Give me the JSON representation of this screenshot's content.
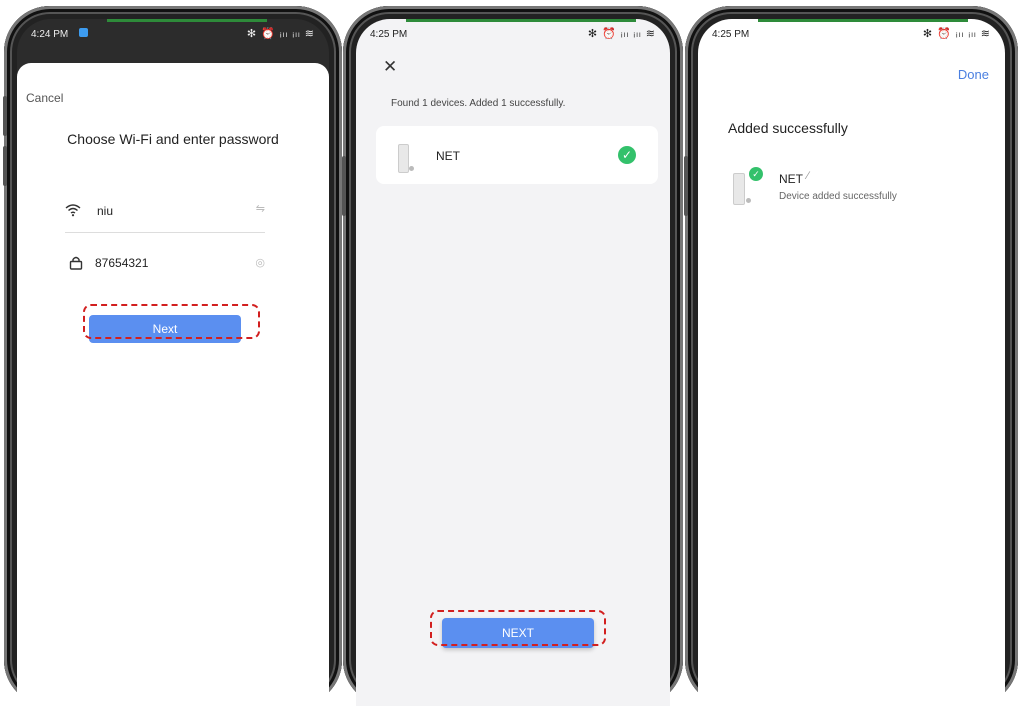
{
  "screens": [
    {
      "status": {
        "time": "4:24 PM",
        "icons": "✻ ⏰ ᵢₗₗ ᵢₗₗ ≋"
      },
      "cancel_label": "Cancel",
      "title": "Choose Wi-Fi and enter password",
      "wifi_name": "niu",
      "password": "87654321",
      "next_label": "Next"
    },
    {
      "status": {
        "time": "4:25 PM",
        "icons": "✻ ⏰ ᵢₗₗ ᵢₗₗ ≋"
      },
      "summary": "Found 1 devices. Added 1 successfully.",
      "device_name": "NET",
      "next_label": "NEXT"
    },
    {
      "status": {
        "time": "4:25 PM",
        "icons": "✻ ⏰ ᵢₗₗ ᵢₗₗ ≋"
      },
      "done_label": "Done",
      "title": "Added successfully",
      "device_name": "NET",
      "device_status": "Device added successfully"
    }
  ],
  "colors": {
    "accent": "#5b8ff0",
    "success": "#33c16b",
    "highlight": "#d21f1f"
  }
}
